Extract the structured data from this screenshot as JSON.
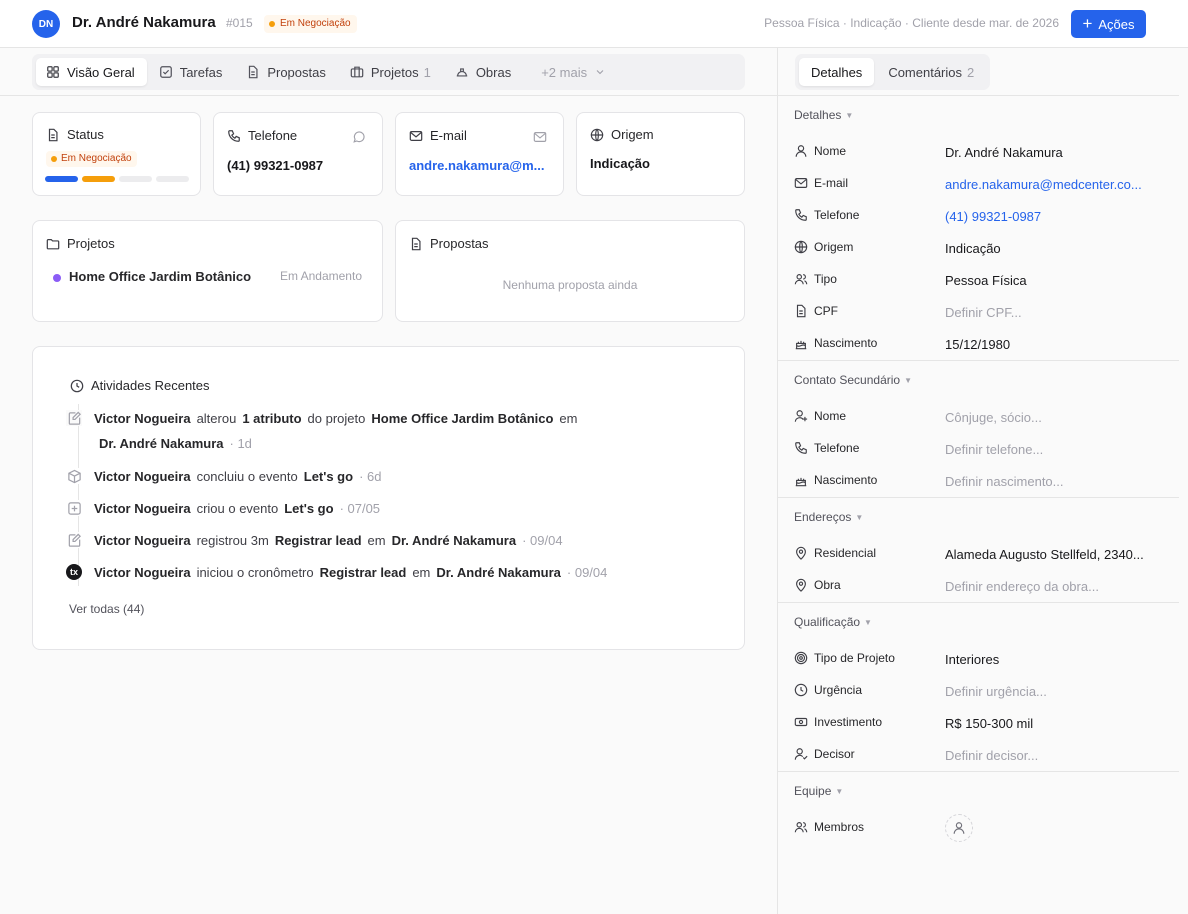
{
  "header": {
    "avatar_initials": "DN",
    "name": "Dr. André Nakamura",
    "id": "#015",
    "status": "Em Negociação",
    "meta": "Pessoa Física · Indicação · Cliente desde mar. de 2026",
    "actions_label": "Ações"
  },
  "tabs": [
    {
      "label": "Visão Geral",
      "icon": "grid-icon"
    },
    {
      "label": "Tarefas",
      "icon": "checkbox-icon"
    },
    {
      "label": "Propostas",
      "icon": "document-icon"
    },
    {
      "label": "Projetos",
      "icon": "briefcase-icon",
      "count": "1"
    },
    {
      "label": "Obras",
      "icon": "hard-hat-icon"
    },
    {
      "label": "+2 mais",
      "icon": "chevron-down-icon"
    }
  ],
  "cards": {
    "status": {
      "title": "Status",
      "value": "Em Negociação",
      "progress_steps": 4,
      "progress_done": 2,
      "step_colors": [
        "#2563eb",
        "#f59e0b",
        "#ececee",
        "#ececee"
      ]
    },
    "phone": {
      "title": "Telefone",
      "value": "(41) 99321-0987"
    },
    "email": {
      "title": "E-mail",
      "value": "andre.nakamura@m..."
    },
    "origin": {
      "title": "Origem",
      "value": "Indicação"
    },
    "projects": {
      "title": "Projetos",
      "item_name": "Home Office Jardim Botânico",
      "item_status": "Em Andamento",
      "item_dot_color": "#8b5cf6"
    },
    "proposals": {
      "title": "Propostas",
      "empty": "Nenhuma proposta ainda"
    }
  },
  "activity": {
    "title": "Atividades Recentes",
    "items": [
      {
        "icon": "edit-icon",
        "actor": "Victor Nogueira",
        "parts": [
          "alterou",
          "1 atributo",
          "do projeto",
          "Home Office Jardim Botânico",
          "em"
        ],
        "line2": "Dr. André Nakamura",
        "time": "· 1d"
      },
      {
        "icon": "box-icon",
        "actor": "Victor Nogueira",
        "parts": [
          "concluiu o evento",
          "Let's go"
        ],
        "time": "· 6d"
      },
      {
        "icon": "plus-square-icon",
        "actor": "Victor Nogueira",
        "parts": [
          "criou o evento",
          "Let's go"
        ],
        "time": "· 07/05"
      },
      {
        "icon": "edit-icon",
        "actor": "Victor Nogueira",
        "parts": [
          "registrou 3m",
          "Registrar lead",
          "em",
          "Dr. André Nakamura"
        ],
        "time": "· 09/04"
      },
      {
        "icon": "tx-icon",
        "actor": "Victor Nogueira",
        "parts": [
          "iniciou o cronômetro",
          "Registrar lead",
          "em",
          "Dr. André Nakamura"
        ],
        "time": "· 09/04",
        "tx_label": "tx"
      }
    ],
    "see_all": "Ver todas (44)"
  },
  "right": {
    "tabs": [
      {
        "label": "Detalhes"
      },
      {
        "label": "Comentários",
        "count": "2"
      }
    ],
    "sections": {
      "details": {
        "title": "Detalhes",
        "rows": [
          {
            "label": "Nome",
            "value": "Dr. André Nakamura"
          },
          {
            "label": "E-mail",
            "value": "andre.nakamura@medcenter.co..."
          },
          {
            "label": "Telefone",
            "value": "(41) 99321-0987"
          },
          {
            "label": "Origem",
            "value": "Indicação"
          },
          {
            "label": "Tipo",
            "value": "Pessoa Física"
          },
          {
            "label": "CPF",
            "value": "Definir CPF..."
          },
          {
            "label": "Nascimento",
            "value": "15/12/1980"
          }
        ]
      },
      "secondary": {
        "title": "Contato Secundário",
        "rows": [
          {
            "label": "Nome",
            "value": "Cônjuge, sócio..."
          },
          {
            "label": "Telefone",
            "value": "Definir telefone..."
          },
          {
            "label": "Nascimento",
            "value": "Definir nascimento..."
          }
        ]
      },
      "addresses": {
        "title": "Endereços",
        "rows": [
          {
            "label": "Residencial",
            "value": "Alameda Augusto Stellfeld, 2340..."
          },
          {
            "label": "Obra",
            "value": "Definir endereço da obra..."
          }
        ]
      },
      "qualification": {
        "title": "Qualificação",
        "rows": [
          {
            "label": "Tipo de Projeto",
            "value": "Interiores"
          },
          {
            "label": "Urgência",
            "value": "Definir urgência..."
          },
          {
            "label": "Investimento",
            "value": "R$ 150-300 mil"
          },
          {
            "label": "Decisor",
            "value": "Definir decisor..."
          }
        ]
      },
      "team": {
        "title": "Equipe",
        "rows": [
          {
            "label": "Membros"
          }
        ]
      }
    }
  }
}
